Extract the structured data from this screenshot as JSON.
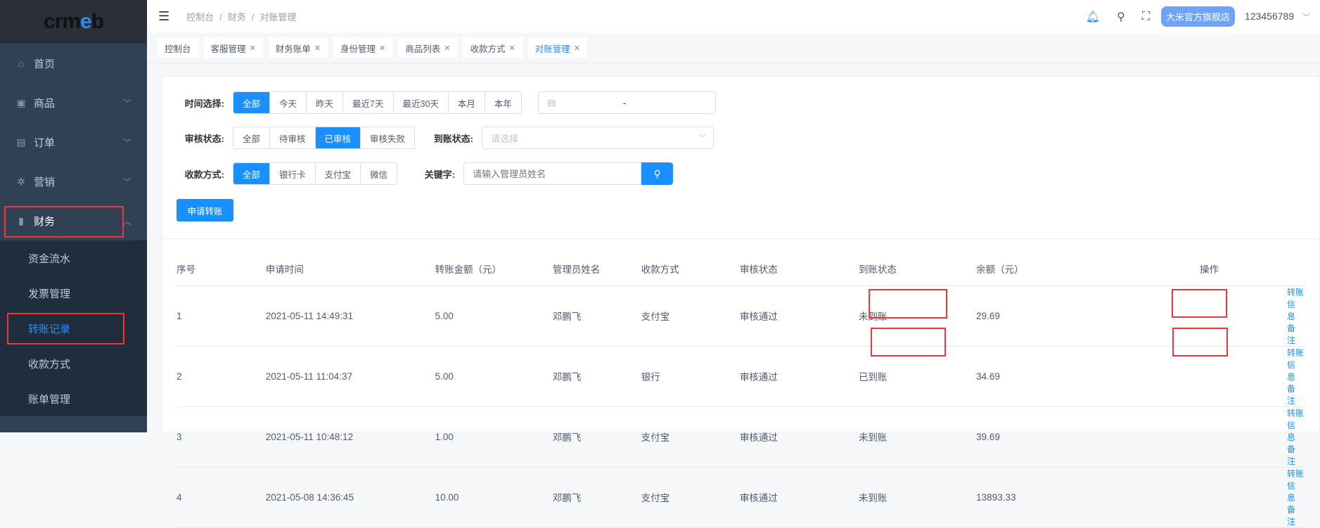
{
  "logo": {
    "text_a": "crm",
    "text_b": "e",
    "text_c": "b"
  },
  "sidebar": {
    "items": [
      {
        "label": "首页",
        "icon": "home-icon"
      },
      {
        "label": "商品",
        "icon": "bag-icon"
      },
      {
        "label": "订单",
        "icon": "clipboard-icon"
      },
      {
        "label": "营销",
        "icon": "aperture-icon"
      },
      {
        "label": "财务",
        "icon": "bar-chart-icon"
      }
    ],
    "submenu": [
      "资金流水",
      "发票管理",
      "转账记录",
      "收款方式",
      "账单管理"
    ]
  },
  "header": {
    "breadcrumb": [
      "控制台",
      "财务",
      "对账管理"
    ],
    "shop": "大米官方旗舰店",
    "user": "123456789"
  },
  "tabs": [
    {
      "label": "控制台",
      "closable": false
    },
    {
      "label": "客服管理",
      "closable": true
    },
    {
      "label": "财务账单",
      "closable": true
    },
    {
      "label": "身份管理",
      "closable": true
    },
    {
      "label": "商品列表",
      "closable": true
    },
    {
      "label": "收款方式",
      "closable": true
    },
    {
      "label": "对账管理",
      "closable": true
    }
  ],
  "filters": {
    "time_label": "时间选择:",
    "time_options": [
      "全部",
      "今天",
      "昨天",
      "最近7天",
      "最近30天",
      "本月",
      "本年"
    ],
    "date_sep": "-",
    "audit_label": "审核状态:",
    "audit_options": [
      "全部",
      "待审核",
      "已审核",
      "审核失败"
    ],
    "arrival_label": "到账状态:",
    "arrival_placeholder": "请选择",
    "method_label": "收款方式:",
    "method_options": [
      "全部",
      "银行卡",
      "支付宝",
      "微信"
    ],
    "keyword_label": "关键字:",
    "keyword_placeholder": "请输入管理员姓名",
    "apply_button": "申请转账"
  },
  "table": {
    "headers": [
      "序号",
      "申请时间",
      "转账金额（元）",
      "管理员姓名",
      "收款方式",
      "审核状态",
      "到账状态",
      "余额（元）",
      "操作"
    ],
    "rows": [
      [
        "1",
        "2021-05-11 14:49:31",
        "5.00",
        "邓鹏飞",
        "支付宝",
        "审核通过",
        "未到账",
        "29.69"
      ],
      [
        "2",
        "2021-05-11 11:04:37",
        "5.00",
        "邓鹏飞",
        "银行",
        "审核通过",
        "已到账",
        "34.69"
      ],
      [
        "3",
        "2021-05-11 10:48:12",
        "1.00",
        "邓鹏飞",
        "支付宝",
        "审核通过",
        "未到账",
        "39.69"
      ],
      [
        "4",
        "2021-05-08 14:36:45",
        "10.00",
        "邓鹏飞",
        "支付宝",
        "审核通过",
        "未到账",
        "13893.33"
      ]
    ],
    "action_info": "转账信息",
    "action_note": "备注"
  },
  "colors": {
    "primary": "#1890ff",
    "sidebar": "#304156",
    "highlight": "#f0353b"
  }
}
